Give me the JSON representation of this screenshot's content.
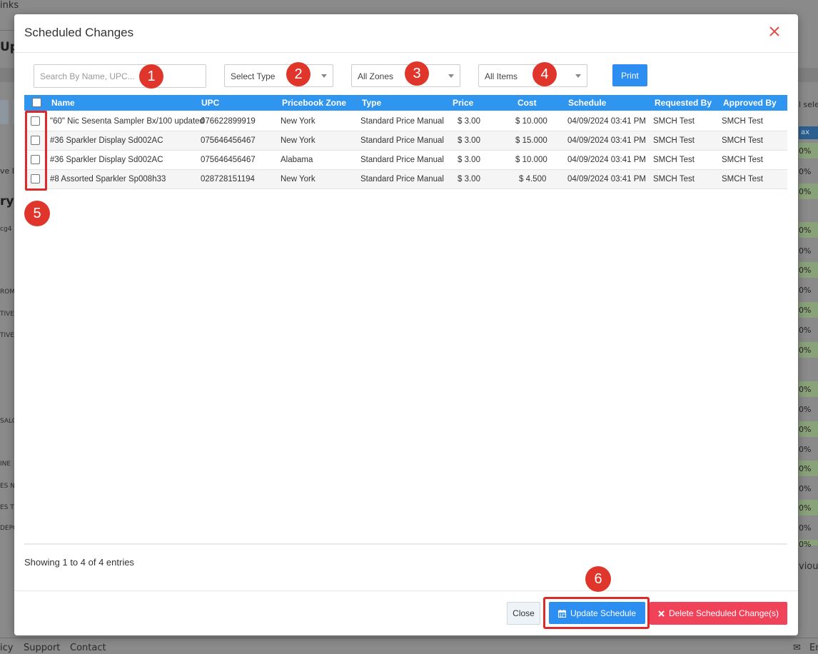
{
  "background": {
    "top_link": "inks",
    "heading_fragment": "Up",
    "heading2_fragment": "ry T",
    "save_fragment": "ve It",
    "code_fragment": "cg4",
    "row_labels": [
      "ROM",
      "TIVE",
      "TIVE",
      "SALO",
      "INE",
      "ES N",
      "ES T",
      "DEPC"
    ],
    "right_select_fragment": "l sele",
    "tax_header": "ax",
    "tax_values": [
      "0%",
      "0%",
      "0%",
      "0%",
      "0%",
      "0%",
      "0%",
      "0%",
      "0%",
      "0%",
      "0%",
      "0%",
      "0%",
      "0%",
      "0%",
      "0%",
      "0%",
      "0%",
      "0%"
    ],
    "previous_fragment": "vious",
    "footer_links": [
      "icy",
      "Support",
      "Contact"
    ],
    "footer_right": "En"
  },
  "modal": {
    "title": "Scheduled Changes",
    "search_placeholder": "Search By Name, UPC...",
    "filters": {
      "type": "Select Type",
      "zones": "All Zones",
      "items": "All Items"
    },
    "print_label": "Print",
    "annotation_badges": [
      "1",
      "2",
      "3",
      "4",
      "5",
      "6"
    ],
    "columns": [
      "Name",
      "UPC",
      "Pricebook Zone",
      "Type",
      "Price",
      "Cost",
      "Schedule",
      "Requested By",
      "Approved By"
    ],
    "rows": [
      {
        "name": "\"60\" Nic Sesenta Sampler Bx/100 updated",
        "upc": "076622899919",
        "zone": "New York",
        "type": "Standard Price Manual",
        "price": "$ 3.00",
        "cost": "$ 10.000",
        "schedule": "04/09/2024 03:41 PM",
        "requested_by": "SMCH Test",
        "approved_by": "SMCH Test"
      },
      {
        "name": "#36 Sparkler Display Sd002AC",
        "upc": "075646456467",
        "zone": "New York",
        "type": "Standard Price Manual",
        "price": "$ 3.00",
        "cost": "$ 15.000",
        "schedule": "04/09/2024 03:41 PM",
        "requested_by": "SMCH Test",
        "approved_by": "SMCH Test"
      },
      {
        "name": "#36 Sparkler Display Sd002AC",
        "upc": "075646456467",
        "zone": "Alabama",
        "type": "Standard Price Manual",
        "price": "$ 3.00",
        "cost": "$ 10.000",
        "schedule": "04/09/2024 03:41 PM",
        "requested_by": "SMCH Test",
        "approved_by": "SMCH Test"
      },
      {
        "name": "#8 Assorted Sparkler Sp008h33",
        "upc": "028728151194",
        "zone": "New York",
        "type": "Standard Price Manual",
        "price": "$ 3.00",
        "cost": "$ 4.500",
        "schedule": "04/09/2024 03:41 PM",
        "requested_by": "SMCH Test",
        "approved_by": "SMCH Test"
      }
    ],
    "entries_info": "Showing 1 to 4 of 4 entries",
    "close_label": "Close",
    "update_label": "Update Schedule",
    "delete_label": "Delete Scheduled Change(s)",
    "colors": {
      "accent": "#2b8ef0",
      "header": "#2f95ee",
      "danger": "#f0435a",
      "highlight": "#dd2a2a"
    }
  }
}
